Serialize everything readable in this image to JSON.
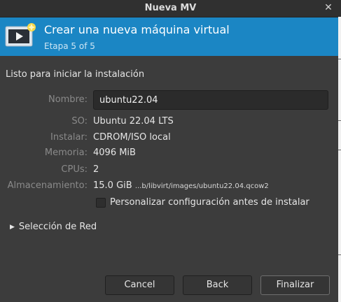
{
  "window": {
    "title": "Nueva MV",
    "close_icon": "close-icon"
  },
  "banner": {
    "heading": "Crear una nueva máquina virtual",
    "step": "Etapa 5 of 5",
    "icon": "new-vm-icon",
    "background": "#1b86c4"
  },
  "section_title": "Listo para iniciar la instalación",
  "fields": {
    "name": {
      "label": "Nombre:",
      "value": "ubuntu22.04"
    },
    "os": {
      "label": "SO:",
      "value": "Ubuntu 22.04 LTS"
    },
    "install": {
      "label": "Instalar:",
      "value": "CDROM/ISO local"
    },
    "memory": {
      "label": "Memoria:",
      "value": "4096 MiB"
    },
    "cpus": {
      "label": "CPUs:",
      "value": "2"
    },
    "storage": {
      "label": "Almacenamiento:",
      "size": "15.0 GiB",
      "path": "...b/libvirt/images/ubuntu22.04.qcow2"
    }
  },
  "customize_checkbox": {
    "label": "Personalizar configuración antes de instalar",
    "checked": false
  },
  "network_expander": {
    "label": "Selección de Red",
    "expanded": false
  },
  "buttons": {
    "cancel": "Cancel",
    "back": "Back",
    "finish": "Finalizar"
  }
}
